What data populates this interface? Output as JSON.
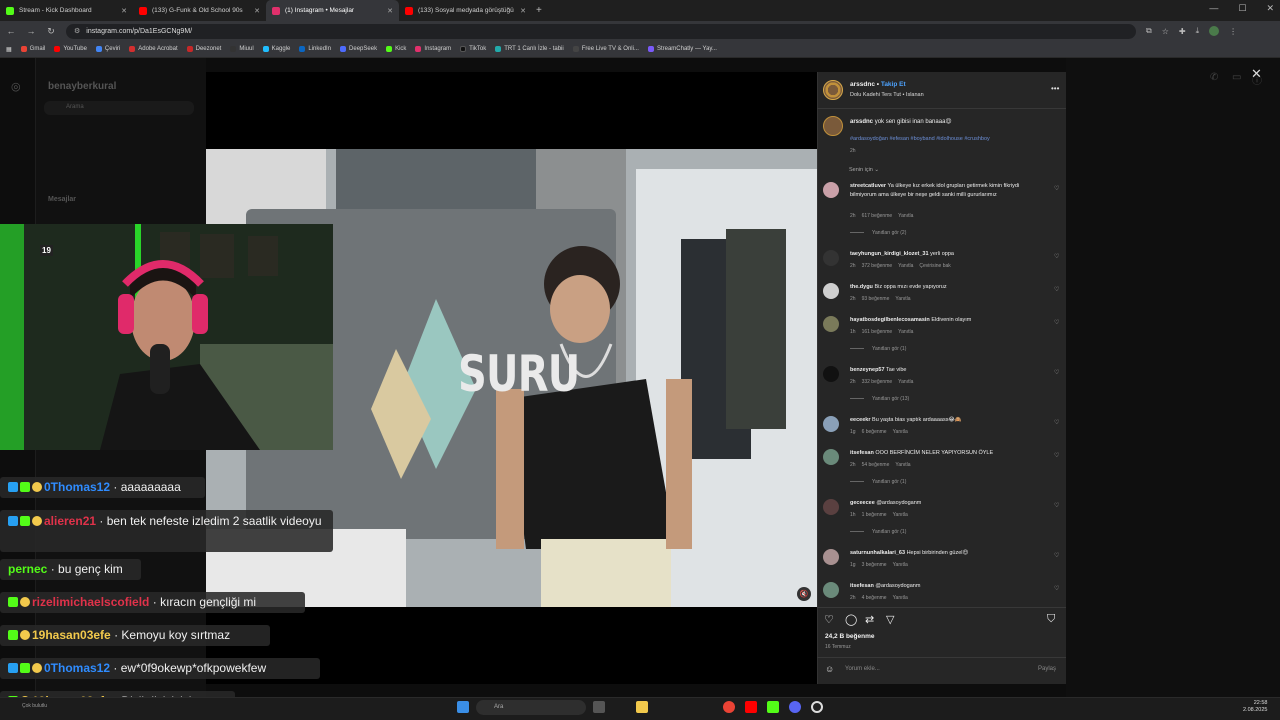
{
  "browser": {
    "tabs": [
      {
        "title": "Stream - Kick Dashboard",
        "color": "#53fc18",
        "active": false
      },
      {
        "title": "(133) G-Funk & Old School 90s",
        "color": "#ff0000",
        "active": false
      },
      {
        "title": "(1) Instagram • Mesajlar",
        "color": "#e1306c",
        "active": true
      },
      {
        "title": "(133) Sosyal medyada görüştüğü",
        "color": "#ff0000",
        "active": false
      }
    ],
    "url": "instagram.com/p/Da1EsGCNg9M/",
    "bookmarks": [
      "Gmail",
      "YouTube",
      "Çeviri",
      "Adobe Acrobat",
      "Deezonet",
      "Miuul",
      "Kaggle",
      "LinkedIn",
      "DeepSeek",
      "Kick",
      "Instagram",
      "TikTok",
      "TRT 1 Canlı İzle - tabii",
      "Free Live TV & Onli...",
      "StreamChatly — Yay..."
    ]
  },
  "instagram_bg": {
    "username": "benayberkural",
    "search_placeholder": "Arama",
    "messages_header": "Mesajlar"
  },
  "video": {
    "overlay_text": "SURU"
  },
  "post": {
    "author": "arssdnc",
    "follow_label": "Takip Et",
    "song": "Dolu Kadehi Ters Tut • Islanan",
    "caption_user": "arssdnc",
    "caption_text": "yok sen gibisi inan banaaa😍",
    "caption_tags": "#ardasoydoğan #efesan #boyband #idolhouse #crushboy",
    "caption_time": "2h",
    "sort_label": "Senin için",
    "likes": "24,2 B beğenme",
    "date": "16 Temmuz",
    "comment_placeholder": "Yorum ekle...",
    "share_label": "Paylaş"
  },
  "comments": [
    {
      "user": "streetcatluver",
      "text": "Ya ülkeye kız erkek idol grupları getirmek kimin fikriydi bilmiyorum ama ülkeye bir neşe geldi sanki milli gururlarımız",
      "time": "2h",
      "likes": "617 beğenme",
      "reply": "Yanıtla",
      "extra": "",
      "replies": "Yanıtları gör (2)",
      "color": "#c9a0a8"
    },
    {
      "user": "taeyhungun_kirdigi_klozet_31",
      "text": "yerli oppa",
      "time": "2h",
      "likes": "372 beğenme",
      "reply": "Yanıtla",
      "extra": "Çevirisine bak",
      "replies": "",
      "color": "#333333"
    },
    {
      "user": "the.dygu",
      "text": "Biz oppa mızı evde yapıyoruz",
      "time": "2h",
      "likes": "93 beğenme",
      "reply": "Yanıtla",
      "extra": "",
      "replies": "",
      "color": "#cfcfcf"
    },
    {
      "user": "hayatbosdegilbenlecosamasin",
      "text": "Eldivenin olayım",
      "time": "1h",
      "likes": "161 beğenme",
      "reply": "Yanıtla",
      "extra": "",
      "replies": "Yanıtları gör (1)",
      "color": "#7a7a5a"
    },
    {
      "user": "benzeynep57",
      "text": "Tae vibe",
      "time": "2h",
      "likes": "332 beğenme",
      "reply": "Yanıtla",
      "extra": "",
      "replies": "Yanıtları gör (13)",
      "color": "#111111"
    },
    {
      "user": "eeceekr",
      "text": "Bu yaşta bias yaptık ardaaaass😂🙈",
      "time": "1g",
      "likes": "6 beğenme",
      "reply": "Yanıtla",
      "extra": "",
      "replies": "",
      "color": "#8aa0b8"
    },
    {
      "user": "itsefesan",
      "text": "OOO BERFİNCİM NELER YAPIYORSUN ÖYLE",
      "time": "2h",
      "likes": "54 beğenme",
      "reply": "Yanıtla",
      "extra": "",
      "replies": "Yanıtları gör (1)",
      "color": "#6a8a7a"
    },
    {
      "user": "geceecee",
      "text": "@ardasoydoganm",
      "time": "1h",
      "likes": "1 beğenme",
      "reply": "Yanıtla",
      "extra": "",
      "replies": "Yanıtları gör (1)",
      "color": "#5a4040"
    },
    {
      "user": "saturnunhalkalari_63",
      "text": "Hepsi birbirinden güzel😍",
      "time": "1g",
      "likes": "3 beğenme",
      "reply": "Yanıtla",
      "extra": "",
      "replies": "",
      "color": "#a89090"
    },
    {
      "user": "itsefesan",
      "text": "@ardasoydoganm",
      "time": "2h",
      "likes": "4 beğenme",
      "reply": "Yanıtla",
      "extra": "",
      "replies": "",
      "color": "#6a8a7a"
    }
  ],
  "stream_chat": [
    {
      "user": "0Thomas12",
      "color": "#2f8cff",
      "message": "aaaaaaaaa"
    },
    {
      "user": "alieren21",
      "color": "#e0324a",
      "message": "ben tek nefeste izledim 2 saatlik videoyu"
    },
    {
      "user": "pernec",
      "color": "#53fc18",
      "message": "bu genç kim"
    },
    {
      "user": "rizelimichaelscofield",
      "color": "#e0324a",
      "message": "kıracın gençliği mi"
    },
    {
      "user": "19hasan03efe",
      "color": "#f2c94c",
      "message": "Kemoyu koy sırtmaz"
    },
    {
      "user": "0Thomas12",
      "color": "#2f8cff",
      "message": "ew*0f9okewp*ofkpowekfew"
    },
    {
      "user": "19hasan03efe",
      "color": "#f2c94c",
      "message": "Djsjkdlslslslsls"
    }
  ],
  "taskbar": {
    "search_label": "Ara",
    "time": "22:58",
    "date": "2.08.2025",
    "weather": "Çok bulutlu"
  }
}
